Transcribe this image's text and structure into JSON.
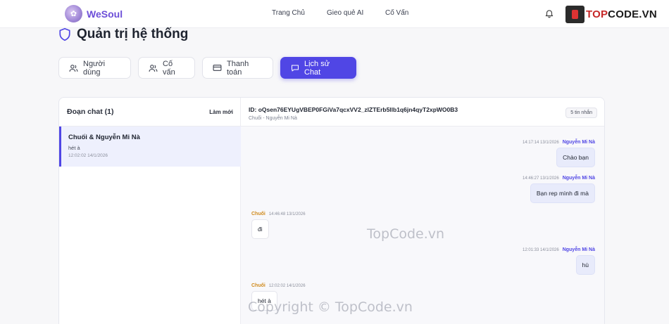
{
  "brand": {
    "name": "WeSoul"
  },
  "nav": {
    "items": [
      "Trang Chủ",
      "Gieo quẻ AI",
      "Cố Vấn"
    ]
  },
  "watermark": {
    "logo_text_red": "TOP",
    "logo_text_dark": "CODE.VN",
    "center": "TopCode.vn",
    "bottom": "Copyright © TopCode.vn"
  },
  "page": {
    "title": "Quản trị hệ thống"
  },
  "tabs": [
    {
      "label": "Người dùng",
      "icon": "users-icon"
    },
    {
      "label": "Cố vấn",
      "icon": "users-icon"
    },
    {
      "label": "Thanh toán",
      "icon": "card-icon"
    },
    {
      "label": "Lịch sử Chat",
      "icon": "chat-icon",
      "active": true
    }
  ],
  "conversations": {
    "title": "Đoạn chat (1)",
    "refresh_label": "Làm mới",
    "items": [
      {
        "name": "Chuối & Nguyễn Mi Nà",
        "last": "hét à",
        "time": "12:02:02 14/1/2026"
      }
    ]
  },
  "chat": {
    "id_line": "ID: oQsen76EYUgVBEP0FGiVa7qcxVV2_zlZTErb5llb1q6jn4qyT2xpWO0B3",
    "members": "Chuối - Nguyễn Mi Nà",
    "count_badge": "5 tin nhắn",
    "messages": [
      {
        "side": "right",
        "time": "14:17:14 13/1/2026",
        "sender": "Nguyễn Mi Nà",
        "text": "Chào bạn"
      },
      {
        "side": "right",
        "time": "14:46:27 13/1/2026",
        "sender": "Nguyễn Mi Nà",
        "text": "Bạn rep mình đi mà"
      },
      {
        "side": "left",
        "time": "14:46:48 13/1/2026",
        "sender": "Chuối",
        "text": "đi"
      },
      {
        "side": "right",
        "time": "12:01:33 14/1/2026",
        "sender": "Nguyễn Mi Nà",
        "text": "hù"
      },
      {
        "side": "left",
        "time": "12:02:02 14/1/2026",
        "sender": "Chuối",
        "text": "hét à"
      }
    ]
  },
  "colors": {
    "accent": "#5046e5",
    "brand": "#6d4fd8",
    "left_sender": "#d08a1c"
  }
}
